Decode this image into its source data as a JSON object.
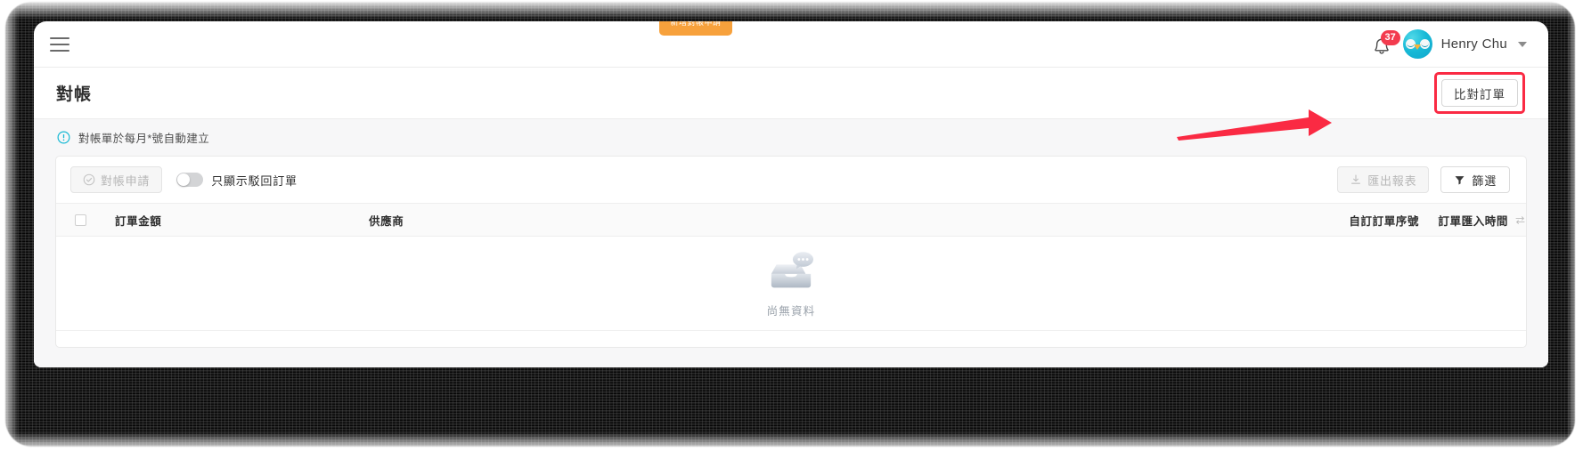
{
  "window": {
    "floating_tab_label": "新增對帳申請"
  },
  "topbar": {
    "menu_icon": "hamburger-menu-icon",
    "notification_icon": "bell-icon",
    "notification_count": "37",
    "avatar_icon": "owl-avatar",
    "username": "Henry Chu",
    "dropdown_icon": "chevron-down-icon"
  },
  "page": {
    "title": "對帳",
    "primary_action": "比對訂單",
    "info_icon": "info-circle-icon",
    "info_text": "對帳單於每月*號自動建立"
  },
  "toolbar": {
    "reconcile_request_label": "對帳申請",
    "reconcile_request_icon": "check-circle-icon",
    "reconcile_request_disabled": true,
    "toggle_label": "只顯示駁回訂單",
    "toggle_on": false,
    "export_label": "匯出報表",
    "export_icon": "download-icon",
    "export_disabled": true,
    "filter_label": "篩選",
    "filter_icon": "funnel-icon"
  },
  "table": {
    "select_all_icon": "checkbox-icon",
    "columns": [
      {
        "label": "訂單金額"
      },
      {
        "label": "供應商"
      },
      {
        "label": "自訂訂單序號"
      },
      {
        "label": "訂單匯入時間",
        "sort_icon": "sort-icon"
      }
    ],
    "rows": [],
    "empty_icon": "empty-inbox-icon",
    "empty_text": "尚無資料"
  },
  "annotation": {
    "arrow_color": "#fa2a43",
    "highlight_color": "#fa2a43",
    "target": "比對訂單"
  },
  "colors": {
    "accent_orange": "#f7a13c",
    "info_teal": "#18b9d4",
    "badge_red": "#f33b4e",
    "annotation_red": "#fa2a43",
    "page_bg": "#f7f7f8"
  }
}
